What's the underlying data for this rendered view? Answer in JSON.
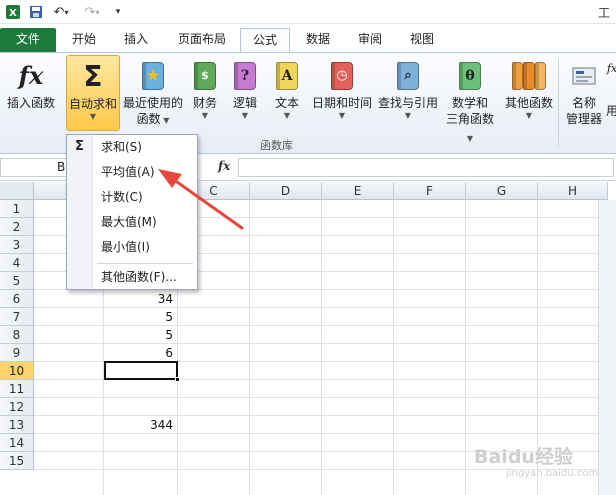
{
  "app": {
    "title_fragment": "工"
  },
  "tabs": [
    {
      "label": "文件"
    },
    {
      "label": "开始"
    },
    {
      "label": "插入"
    },
    {
      "label": "页面布局"
    },
    {
      "label": "公式"
    },
    {
      "label": "数据"
    },
    {
      "label": "审阅"
    },
    {
      "label": "视图"
    }
  ],
  "ribbon": {
    "group_label": "函数库",
    "buttons": [
      {
        "label": "插入函数",
        "icon": "fx-icon"
      },
      {
        "label": "自动求和",
        "icon": "sigma-icon"
      },
      {
        "label_line1": "最近使用的",
        "label_line2": "函数",
        "icon": "star-book-icon"
      },
      {
        "label": "财务",
        "icon": "finance-book-icon"
      },
      {
        "label": "逻辑",
        "icon": "logic-book-icon",
        "glyph": "?"
      },
      {
        "label": "文本",
        "icon": "text-book-icon",
        "glyph": "A"
      },
      {
        "label": "日期和时间",
        "icon": "clock-book-icon"
      },
      {
        "label": "查找与引用",
        "icon": "search-book-icon"
      },
      {
        "label_line1": "数学和",
        "label_line2": "三角函数",
        "icon": "theta-book-icon",
        "glyph": "θ"
      },
      {
        "label": "其他函数",
        "icon": "books-icon"
      },
      {
        "label_line1": "名称",
        "label_line2": "管理器",
        "icon": "name-manager-icon"
      },
      {
        "label_line1": "fx",
        "label_line2": "用",
        "icon": "define-name-icon"
      }
    ]
  },
  "formula_bar": {
    "name_box": "B",
    "fx": "fx"
  },
  "columns": [
    "C",
    "D",
    "E",
    "F",
    "G",
    "H"
  ],
  "rows": [
    "1",
    "2",
    "3",
    "4",
    "5",
    "6",
    "7",
    "8",
    "9",
    "10",
    "11",
    "12",
    "13",
    "14",
    "15"
  ],
  "selected_row": "10",
  "cells": [
    {
      "row": "6",
      "value": "34"
    },
    {
      "row": "7",
      "value": "5"
    },
    {
      "row": "8",
      "value": "5"
    },
    {
      "row": "9",
      "value": "6"
    },
    {
      "row": "13",
      "value": "344"
    }
  ],
  "dropdown": {
    "items": [
      {
        "label": "求和(S)"
      },
      {
        "label": "平均值(A)"
      },
      {
        "label": "计数(C)"
      },
      {
        "label": "最大值(M)"
      },
      {
        "label": "最小值(I)"
      },
      {
        "label": "其他函数(F)..."
      }
    ]
  },
  "watermark": {
    "text": "Baidu经验",
    "url": "jingyan.baidu.com"
  },
  "colors": {
    "file_tab": "#1e7a3b",
    "pressed": "#ffc94a",
    "arrow": "#e8473f",
    "selected_row": "#ffd56a"
  }
}
